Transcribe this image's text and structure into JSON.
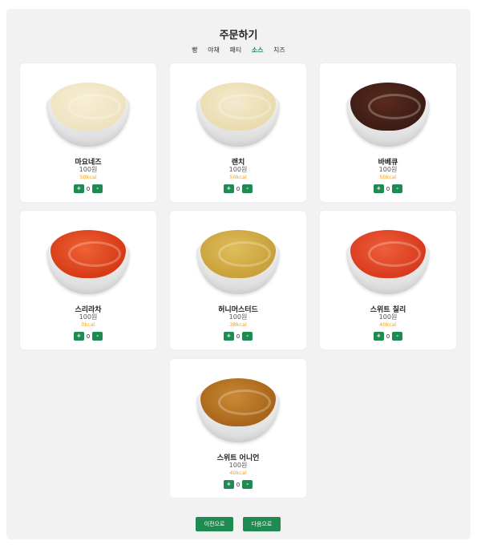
{
  "page": {
    "title": "주문하기"
  },
  "tabs": [
    {
      "label": "빵",
      "active": false
    },
    {
      "label": "야채",
      "active": false
    },
    {
      "label": "패티",
      "active": false
    },
    {
      "label": "소스",
      "active": true
    },
    {
      "label": "치즈",
      "active": false
    }
  ],
  "products": [
    {
      "name": "마요네즈",
      "price": "100원",
      "kcal": "50kcal",
      "qty": "0",
      "sauce_color": "#eee3bf",
      "sauce_color2": "#f7efd6"
    },
    {
      "name": "랜치",
      "price": "100원",
      "kcal": "50kcal",
      "qty": "0",
      "sauce_color": "#eadbad",
      "sauce_color2": "#f4ead0"
    },
    {
      "name": "바베큐",
      "price": "100원",
      "kcal": "50kcal",
      "qty": "0",
      "sauce_color": "#3b1c14",
      "sauce_color2": "#5a2a1c"
    },
    {
      "name": "스리라차",
      "price": "100원",
      "kcal": "0kcal",
      "qty": "0",
      "sauce_color": "#d63a16",
      "sauce_color2": "#ef6234"
    },
    {
      "name": "허니머스터드",
      "price": "100원",
      "kcal": "38kcal",
      "qty": "0",
      "sauce_color": "#c9a03a",
      "sauce_color2": "#dfbe5c"
    },
    {
      "name": "스위트 칠리",
      "price": "100원",
      "kcal": "40kcal",
      "qty": "0",
      "sauce_color": "#d83a1e",
      "sauce_color2": "#ee5f3a"
    },
    {
      "name": "스위트 어니언",
      "price": "100원",
      "kcal": "40kcal",
      "qty": "0",
      "sauce_color": "#a8641a",
      "sauce_color2": "#c98a34"
    }
  ],
  "buttons": {
    "plus": "+",
    "minus": "-",
    "prev": "이전으로",
    "next": "다음으로"
  },
  "colors": {
    "accent": "#1f8a52",
    "kcal": "#f0a020",
    "panel": "#f2f2f2"
  }
}
